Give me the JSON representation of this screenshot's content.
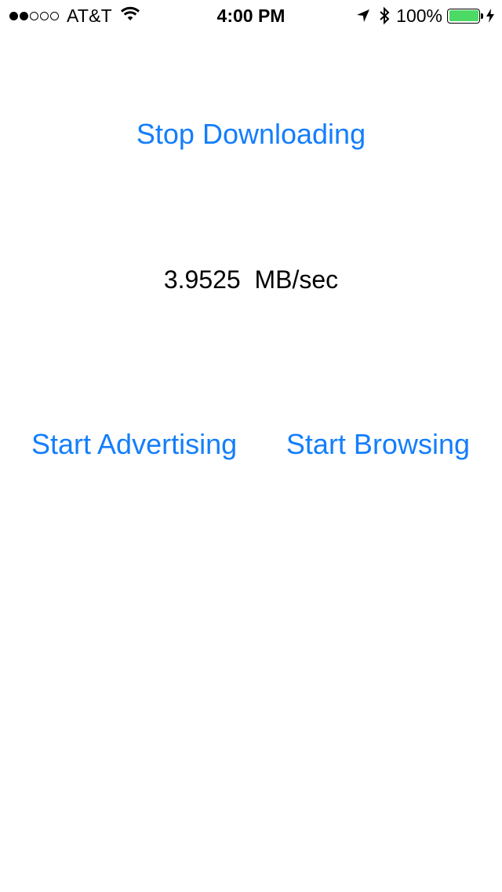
{
  "status_bar": {
    "signal_bars_filled": 2,
    "signal_bars_total": 5,
    "carrier": "AT&T",
    "time": "4:00 PM",
    "battery_percent": "100%",
    "battery_level": 1.0,
    "icons": [
      "wifi-icon",
      "location-arrow-icon",
      "bluetooth-icon",
      "battery-icon",
      "charging-bolt-icon"
    ],
    "colors": {
      "battery_fill": "#4cd964"
    }
  },
  "main": {
    "stop_download_label": "Stop Downloading",
    "speed_value": "3.9525",
    "speed_unit": "MB/sec",
    "advertise_label": "Start Advertising",
    "browse_label": "Start Browsing",
    "colors": {
      "accent": "#147efb",
      "text": "#000000",
      "background": "#ffffff"
    }
  }
}
